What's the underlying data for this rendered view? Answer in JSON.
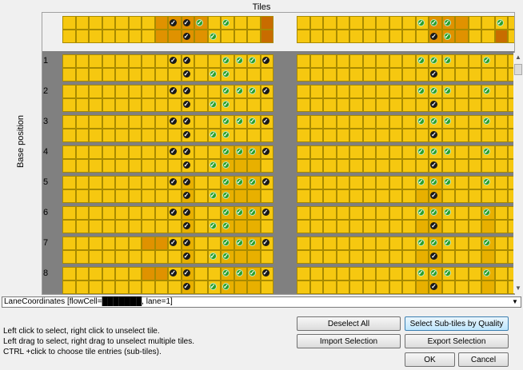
{
  "title": "Tiles",
  "y_axis_label": "Base position",
  "row_labels": [
    "1",
    "2",
    "3",
    "4",
    "5",
    "6",
    "7",
    "8"
  ],
  "combo": {
    "value": "LaneCoordinates [flowCell=███████, lane=1]"
  },
  "help": [
    "Left click to select, right click to unselect tile.",
    "Left drag to select, right drag to unselect multiple tiles.",
    "CTRL +click to choose tile entries (sub-tiles)."
  ],
  "buttons": {
    "deselect_all": "Deselect All",
    "select_subtiles": "Select Sub-tiles by Quality",
    "import_selection": "Import Selection",
    "export_selection": "Export Selection",
    "ok": "OK",
    "cancel": "Cancel"
  },
  "colors": {
    "selected": "#1a1a1a",
    "quality": "#2aa02a",
    "tile": "#f3cd00",
    "hot": "#c86c00",
    "gap": "#808080"
  }
}
